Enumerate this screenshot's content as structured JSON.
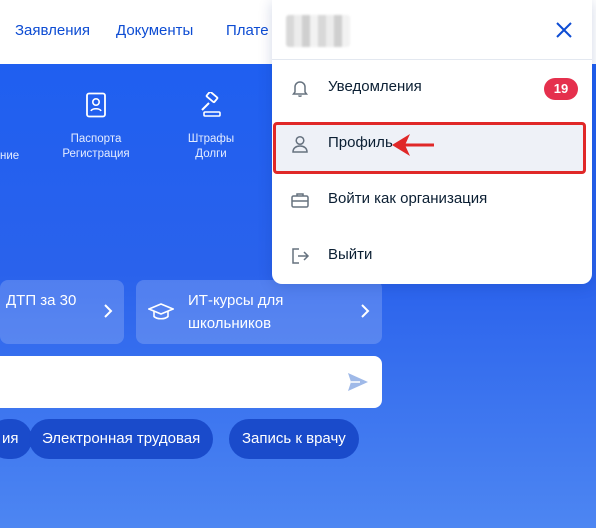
{
  "nav": {
    "links": [
      "Заявления",
      "Документы",
      "Плате"
    ]
  },
  "services": {
    "partial_label": "ние",
    "items": [
      {
        "line1": "Паспорта",
        "line2": "Регистрация",
        "icon": "passport-icon"
      },
      {
        "line1": "Штрафы",
        "line2": "Долги",
        "icon": "gavel-icon"
      }
    ]
  },
  "cards": [
    {
      "title": "ДТП за 30",
      "icon": "chevron-right-icon"
    },
    {
      "title_line1": "ИТ-курсы для",
      "title_line2": "школьников",
      "icon": "graduation-cap-icon"
    }
  ],
  "search": {
    "placeholder": "",
    "send_icon": "send-arrow-icon"
  },
  "chips": [
    "ия",
    "Электронная трудовая",
    "Запись к врачу"
  ],
  "menu": {
    "close_icon": "close-icon",
    "items": [
      {
        "label": "Уведомления",
        "icon": "bell-icon",
        "badge": "19"
      },
      {
        "label": "Профиль",
        "icon": "person-icon"
      },
      {
        "label": "Войти как организация",
        "icon": "briefcase-icon"
      },
      {
        "label": "Выйти",
        "icon": "logout-icon"
      }
    ]
  },
  "colors": {
    "brand_blue": "#0d4cd3",
    "badge_red": "#e5304d",
    "highlight_red": "#e02828"
  }
}
